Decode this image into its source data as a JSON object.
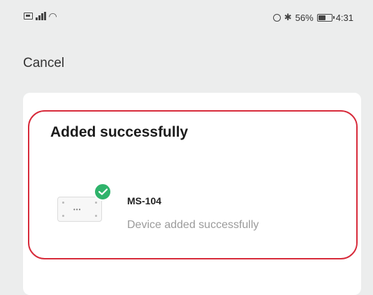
{
  "status_bar": {
    "battery_percent": "56%",
    "battery_level": 0.56,
    "time": "4:31"
  },
  "header": {
    "cancel_label": "Cancel"
  },
  "result": {
    "title": "Added successfully",
    "device": {
      "name": "MS-104",
      "status": "Device added successfully"
    }
  },
  "colors": {
    "highlight": "#d72a3a",
    "success": "#2fb36b",
    "background": "#eceded",
    "card": "#ffffff"
  },
  "icons": [
    "sim-icon",
    "signal-icon",
    "wifi-icon",
    "alarm-icon",
    "bluetooth-icon",
    "battery-icon",
    "check-icon"
  ]
}
